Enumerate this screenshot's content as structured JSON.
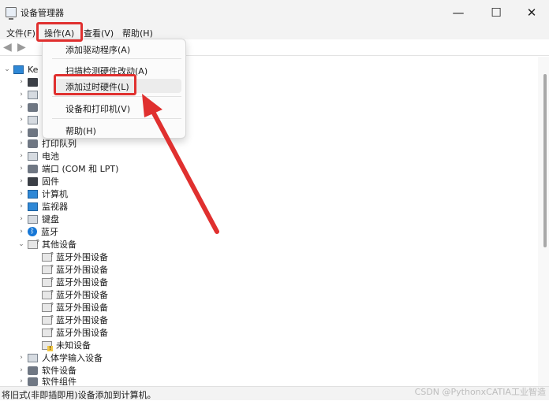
{
  "window": {
    "title": "设备管理器",
    "min": "—",
    "max": "☐",
    "close": "✕"
  },
  "menu": {
    "file": "文件(F)",
    "action": "操作(A)",
    "view": "查看(V)",
    "help": "帮助(H)"
  },
  "action_menu": {
    "items": [
      "添加驱动程序(A)",
      "扫描检测硬件改动(A)",
      "添加过时硬件(L)",
      "设备和打印机(V)",
      "帮助(H)"
    ],
    "highlighted_index": 2
  },
  "tree": {
    "root": "Ke",
    "items": [
      {
        "label": "打印队列",
        "icon": "printer-icon"
      },
      {
        "label": "电池",
        "icon": "battery-icon"
      },
      {
        "label": "端口 (COM 和 LPT)",
        "icon": "port-icon"
      },
      {
        "label": "固件",
        "icon": "firmware-icon"
      },
      {
        "label": "计算机",
        "icon": "computer-icon"
      },
      {
        "label": "监视器",
        "icon": "monitor-icon"
      },
      {
        "label": "键盘",
        "icon": "keyboard-icon"
      },
      {
        "label": "蓝牙",
        "icon": "bluetooth-icon"
      },
      {
        "label": "其他设备",
        "icon": "other-devices-icon",
        "expanded": true
      }
    ],
    "other_devices_children": [
      {
        "label": "蓝牙外围设备",
        "icon": "unknown-device-icon"
      },
      {
        "label": "蓝牙外围设备",
        "icon": "unknown-device-icon"
      },
      {
        "label": "蓝牙外围设备",
        "icon": "unknown-device-icon"
      },
      {
        "label": "蓝牙外围设备",
        "icon": "unknown-device-icon"
      },
      {
        "label": "蓝牙外围设备",
        "icon": "unknown-device-icon"
      },
      {
        "label": "蓝牙外围设备",
        "icon": "unknown-device-icon"
      },
      {
        "label": "蓝牙外围设备",
        "icon": "unknown-device-icon"
      },
      {
        "label": "未知设备",
        "icon": "warning-device-icon"
      }
    ],
    "after_items": [
      {
        "label": "人体学输入设备",
        "icon": "hid-icon"
      },
      {
        "label": "软件设备",
        "icon": "software-device-icon"
      },
      {
        "label": "软件组件",
        "icon": "software-component-icon"
      }
    ]
  },
  "status": {
    "text": "将旧式(非即插即用)设备添加到计算机。"
  },
  "watermark": "CSDN @PythonxCATIA工业智造",
  "colors": {
    "annotation": "#e0302f",
    "menu_bg": "#fbfbfb",
    "titlebar": "#f3f3f3"
  }
}
